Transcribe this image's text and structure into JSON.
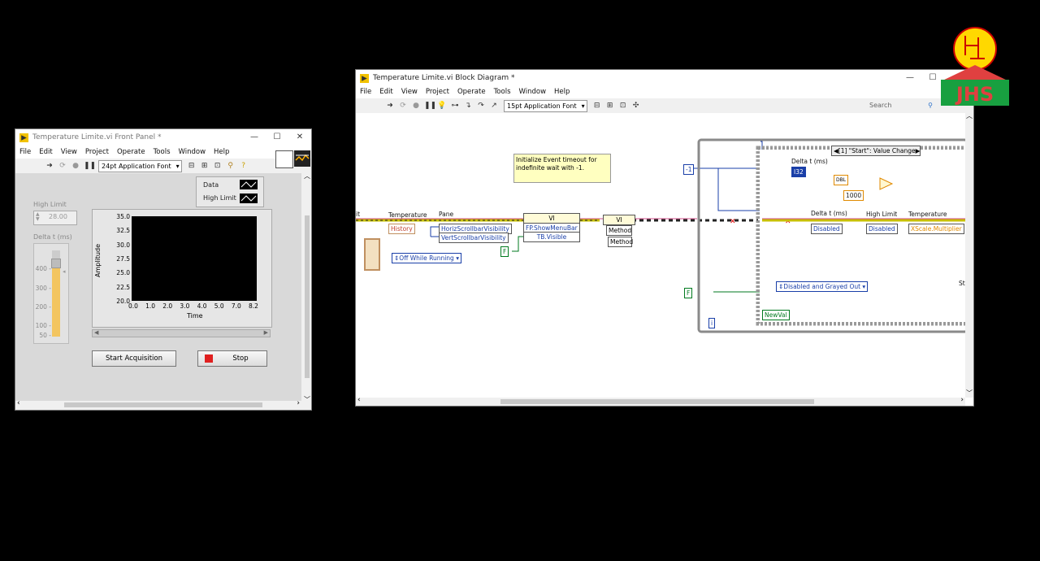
{
  "front_panel": {
    "title": "Temperature Limite.vi Front Panel *",
    "menu": [
      "File",
      "Edit",
      "View",
      "Project",
      "Operate",
      "Tools",
      "Window",
      "Help"
    ],
    "font": "24pt Application Font",
    "legend": [
      "Data",
      "High Limit"
    ],
    "high_limit_label": "High Limit",
    "high_limit_value": "28.00",
    "delta_label": "Delta t (ms)",
    "slider_ticks": [
      "400 -",
      "300 -",
      "200 -",
      "100 -",
      "50 -"
    ],
    "slider_level": 0.85,
    "chart": {
      "ylabel": "Amplitude",
      "xlabel": "Time",
      "yticks": [
        "35.0",
        "32.5",
        "30.0",
        "27.5",
        "25.0",
        "22.5",
        "20.0"
      ],
      "xticks": [
        "0.0",
        "1.0",
        "2.0",
        "3.0",
        "4.0",
        "5.0",
        "7.0",
        "8.2"
      ]
    },
    "start_button": "Start Acquisition",
    "stop_button": "Stop"
  },
  "block_diagram": {
    "title": "Temperature Limite.vi Block Diagram *",
    "menu": [
      "File",
      "Edit",
      "View",
      "Project",
      "Operate",
      "Tools",
      "Window",
      "Help"
    ],
    "font": "15pt Application Font",
    "search_placeholder": "Search",
    "comment": "Initialize Event timeout for indefinite wait with -1.",
    "labels": {
      "it": "it",
      "temperature": "Temperature",
      "pane": "Pane",
      "history": "History",
      "horiz": "HorizScrollbarVisibility",
      "vert": "VertScrollbarVisibility",
      "off_while_running": "Off While Running",
      "vi_node": "VI",
      "show_menubar": "FP.ShowMenuBar",
      "tb_visible": "TB.Visible",
      "vi_node2": "VI",
      "method1": "Method",
      "method2": "Method",
      "f1": "F",
      "minus_one": "-1",
      "event_case": "[1] \"Start\": Value Change",
      "delta_t_1": "Delta t (ms)",
      "i32": "I32",
      "dbl": "DBL",
      "const_1000": "1000",
      "delta_t_2": "Delta t (ms)",
      "disabled1": "Disabled",
      "high_limit": "High Limit",
      "disabled2": "Disabled",
      "temperature2": "Temperature",
      "xscale": "XScale.Multiplier",
      "disabled_grayed": "Disabled and Grayed Out",
      "f2": "F",
      "newval": "NewVal",
      "i_terminal": "i",
      "st": "St"
    }
  },
  "logo_text": "JHS",
  "colors": {
    "blue_wire": "#1a3fa8",
    "orange_wire": "#e08a00",
    "pink_wire": "#d24e88",
    "green_wire": "#007a1f",
    "comment_bg": "#ffffc0"
  }
}
